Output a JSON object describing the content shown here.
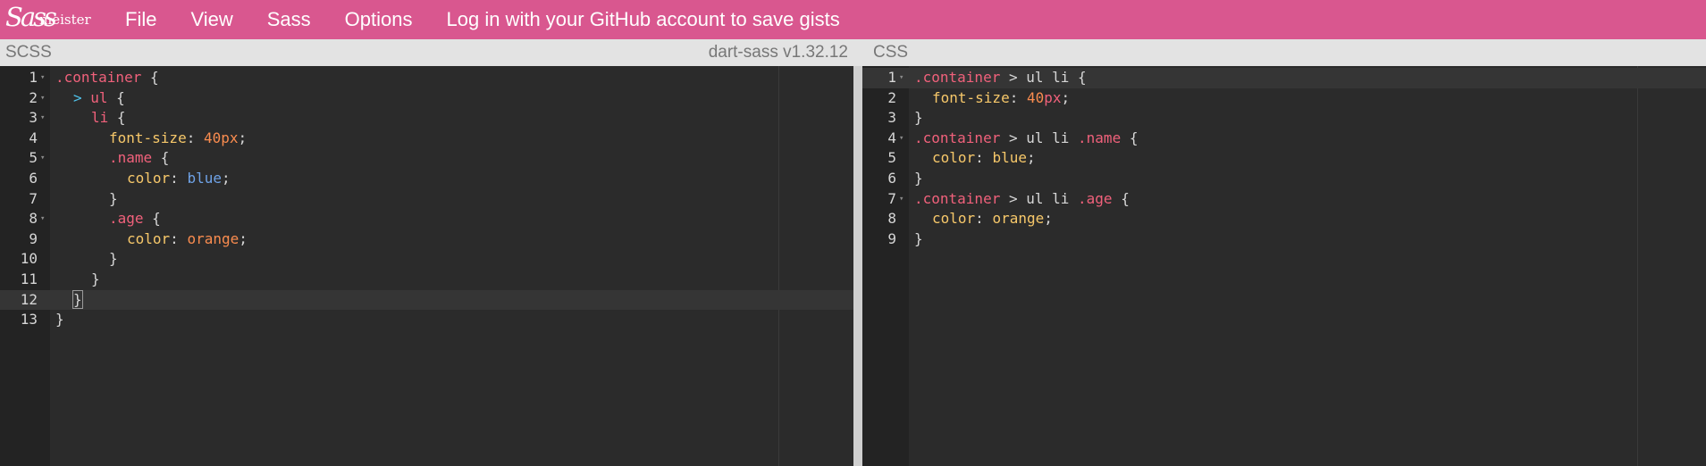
{
  "logo": {
    "sass": "Sass",
    "meister": "meister"
  },
  "menu": [
    {
      "label": "File"
    },
    {
      "label": "View"
    },
    {
      "label": "Sass"
    },
    {
      "label": "Options"
    },
    {
      "label": "Log in with your GitHub account to save gists"
    }
  ],
  "left_panel": {
    "title": "SCSS",
    "compiler": "dart-sass v1.32.12",
    "active_line": 12,
    "lines": [
      {
        "n": "1",
        "fold": true,
        "indent": 0,
        "tokens": [
          {
            "t": ".container",
            "c": "t-class"
          },
          {
            "t": " {",
            "c": "t-punct"
          }
        ]
      },
      {
        "n": "2",
        "fold": true,
        "indent": 1,
        "tokens": [
          {
            "t": "> ",
            "c": "t-op"
          },
          {
            "t": "ul ",
            "c": "t-tag"
          },
          {
            "t": "{",
            "c": "t-punct"
          }
        ]
      },
      {
        "n": "3",
        "fold": true,
        "indent": 2,
        "tokens": [
          {
            "t": "li ",
            "c": "t-tag"
          },
          {
            "t": "{",
            "c": "t-punct"
          }
        ]
      },
      {
        "n": "4",
        "fold": false,
        "indent": 3,
        "tokens": [
          {
            "t": "font-size",
            "c": "t-prop"
          },
          {
            "t": ": ",
            "c": "t-punct"
          },
          {
            "t": "40px",
            "c": "t-num"
          },
          {
            "t": ";",
            "c": "t-punct"
          }
        ]
      },
      {
        "n": "5",
        "fold": true,
        "indent": 3,
        "tokens": [
          {
            "t": ".name",
            "c": "t-class"
          },
          {
            "t": " {",
            "c": "t-punct"
          }
        ]
      },
      {
        "n": "6",
        "fold": false,
        "indent": 4,
        "tokens": [
          {
            "t": "color",
            "c": "t-prop"
          },
          {
            "t": ": ",
            "c": "t-punct"
          },
          {
            "t": "blue",
            "c": "t-kw"
          },
          {
            "t": ";",
            "c": "t-punct"
          }
        ]
      },
      {
        "n": "7",
        "fold": false,
        "indent": 3,
        "tokens": [
          {
            "t": "}",
            "c": "t-punct"
          }
        ]
      },
      {
        "n": "8",
        "fold": true,
        "indent": 3,
        "tokens": [
          {
            "t": ".age",
            "c": "t-class"
          },
          {
            "t": " {",
            "c": "t-punct"
          }
        ]
      },
      {
        "n": "9",
        "fold": false,
        "indent": 4,
        "tokens": [
          {
            "t": "color",
            "c": "t-prop"
          },
          {
            "t": ": ",
            "c": "t-punct"
          },
          {
            "t": "orange",
            "c": "t-num"
          },
          {
            "t": ";",
            "c": "t-punct"
          }
        ]
      },
      {
        "n": "10",
        "fold": false,
        "indent": 3,
        "tokens": [
          {
            "t": "}",
            "c": "t-punct"
          }
        ]
      },
      {
        "n": "11",
        "fold": false,
        "indent": 2,
        "tokens": [
          {
            "t": "}",
            "c": "t-punct"
          }
        ]
      },
      {
        "n": "12",
        "fold": false,
        "indent": 1,
        "tokens": [
          {
            "t": "}",
            "c": "t-punct bracket-hl"
          }
        ]
      },
      {
        "n": "13",
        "fold": false,
        "indent": 0,
        "tokens": [
          {
            "t": "}",
            "c": "t-punct"
          }
        ]
      }
    ]
  },
  "right_panel": {
    "title": "CSS",
    "active_line": 1,
    "lines": [
      {
        "n": "1",
        "fold": true,
        "indent": 0,
        "tokens": [
          {
            "t": ".container",
            "c": "t-class"
          },
          {
            "t": " > ul li {",
            "c": "t-punct"
          }
        ]
      },
      {
        "n": "2",
        "fold": false,
        "indent": 1,
        "tokens": [
          {
            "t": "font-size",
            "c": "t-prop"
          },
          {
            "t": ": ",
            "c": "t-punct"
          },
          {
            "t": "40",
            "c": "t-num"
          },
          {
            "t": "px",
            "c": "t-unit"
          },
          {
            "t": ";",
            "c": "t-punct"
          }
        ]
      },
      {
        "n": "3",
        "fold": false,
        "indent": 0,
        "tokens": [
          {
            "t": "}",
            "c": "t-punct"
          }
        ]
      },
      {
        "n": "4",
        "fold": true,
        "indent": 0,
        "tokens": [
          {
            "t": ".container",
            "c": "t-class"
          },
          {
            "t": " > ul li ",
            "c": "t-punct"
          },
          {
            "t": ".name",
            "c": "t-class"
          },
          {
            "t": " {",
            "c": "t-punct"
          }
        ]
      },
      {
        "n": "5",
        "fold": false,
        "indent": 1,
        "tokens": [
          {
            "t": "color",
            "c": "t-prop"
          },
          {
            "t": ": ",
            "c": "t-punct"
          },
          {
            "t": "blue",
            "c": "t-prop"
          },
          {
            "t": ";",
            "c": "t-punct"
          }
        ]
      },
      {
        "n": "6",
        "fold": false,
        "indent": 0,
        "tokens": [
          {
            "t": "}",
            "c": "t-punct"
          }
        ]
      },
      {
        "n": "7",
        "fold": true,
        "indent": 0,
        "tokens": [
          {
            "t": ".container",
            "c": "t-class"
          },
          {
            "t": " > ul li ",
            "c": "t-punct"
          },
          {
            "t": ".age",
            "c": "t-class"
          },
          {
            "t": " {",
            "c": "t-punct"
          }
        ]
      },
      {
        "n": "8",
        "fold": false,
        "indent": 1,
        "tokens": [
          {
            "t": "color",
            "c": "t-prop"
          },
          {
            "t": ": ",
            "c": "t-punct"
          },
          {
            "t": "orange",
            "c": "t-prop"
          },
          {
            "t": ";",
            "c": "t-punct"
          }
        ]
      },
      {
        "n": "9",
        "fold": false,
        "indent": 0,
        "tokens": [
          {
            "t": "}",
            "c": "t-punct"
          }
        ]
      }
    ]
  },
  "colors": {
    "topbar": "#d9578f",
    "editor_bg": "#2b2b2b",
    "selector": "#f0617b",
    "property": "#f7c86a",
    "number": "#fa8c4f",
    "keyword": "#6fa3e8"
  }
}
